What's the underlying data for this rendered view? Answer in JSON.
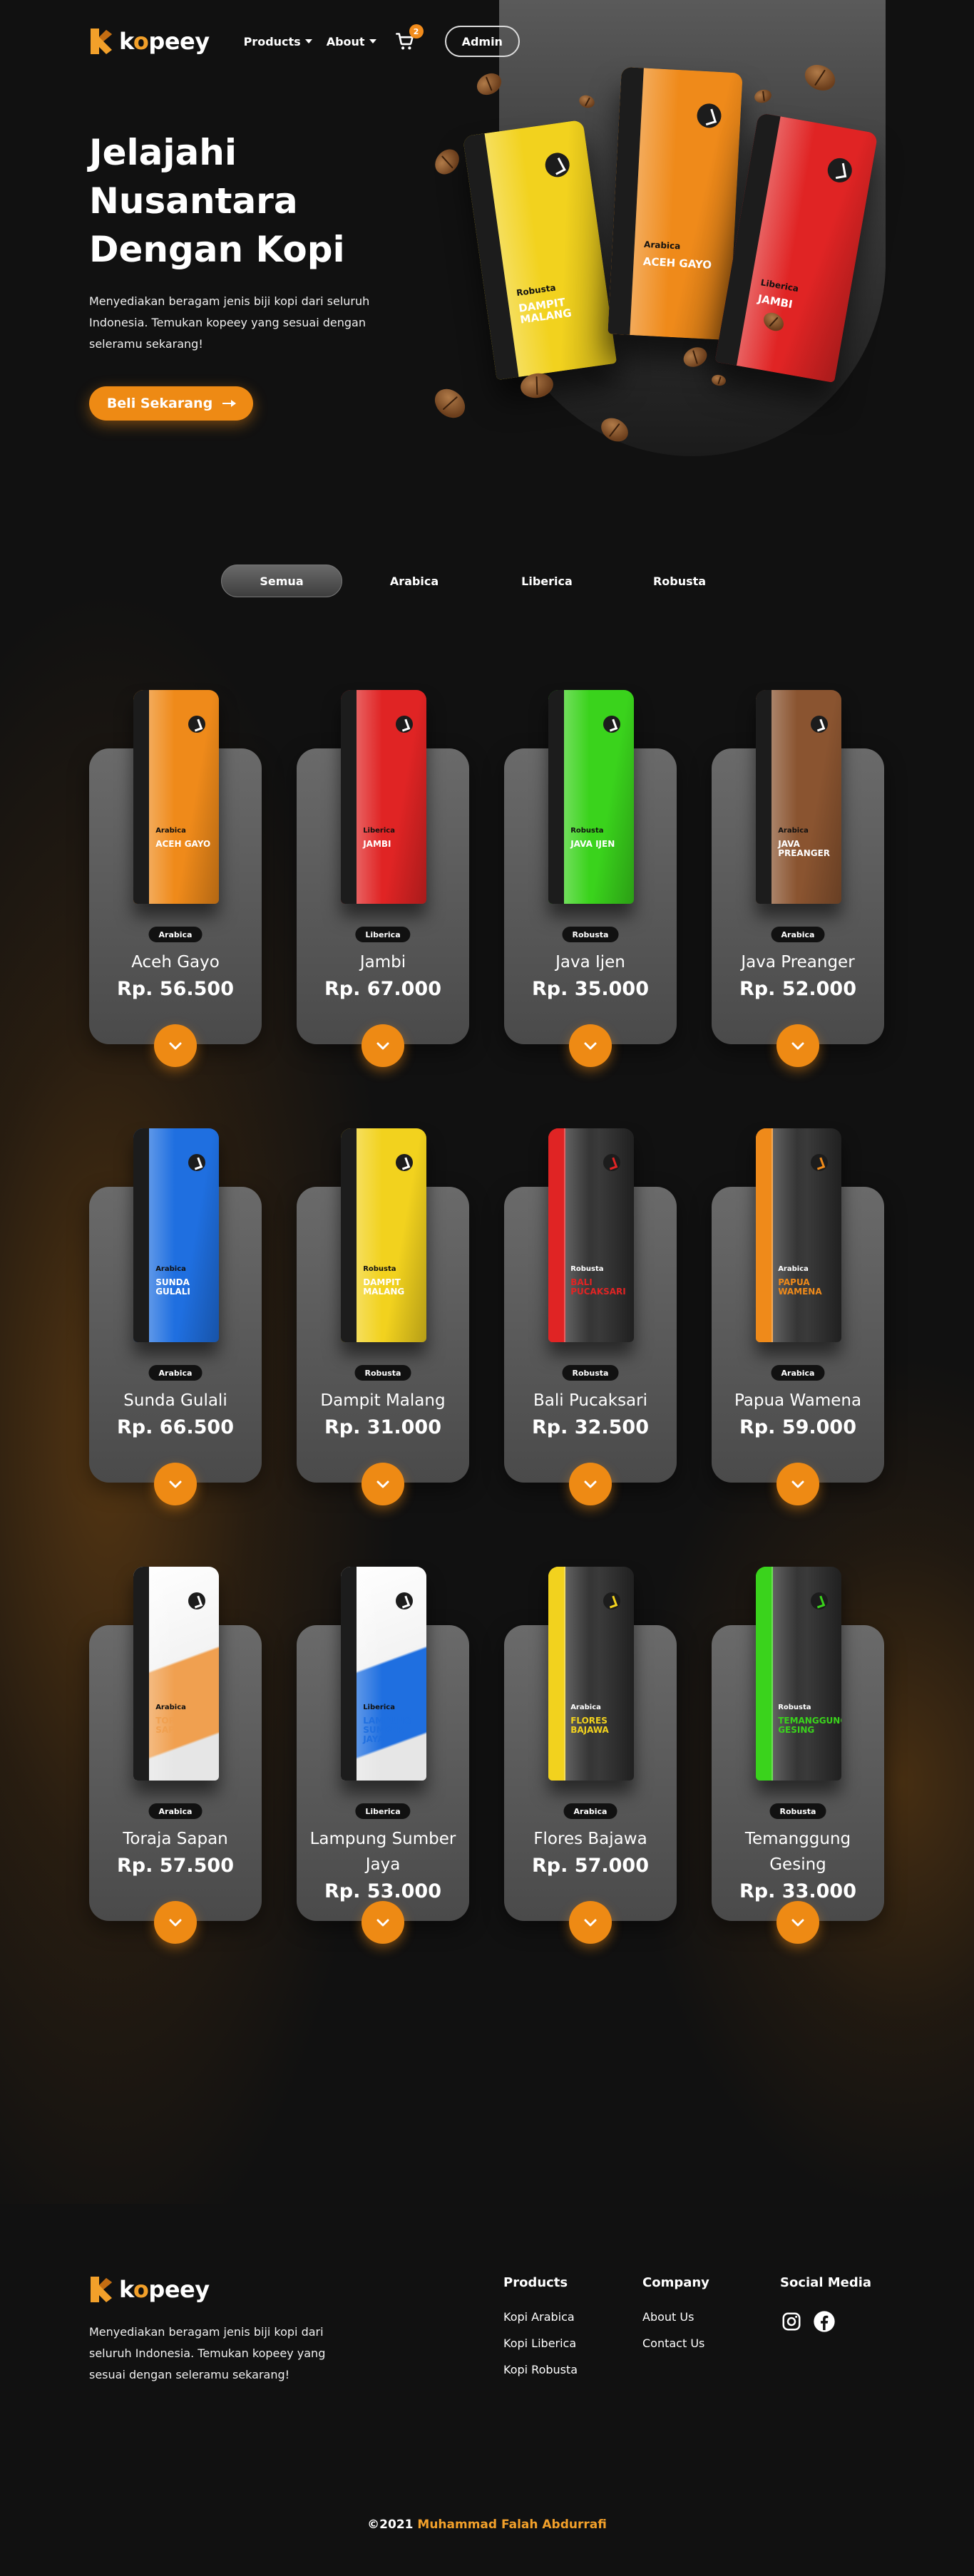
{
  "brand": {
    "name_prefix": "k",
    "name_o": "o",
    "name_suffix": "peey",
    "accent_color": "#ee8a14"
  },
  "nav": {
    "products_label": "Products",
    "about_label": "About",
    "cart_count": "2",
    "admin_label": "Admin"
  },
  "hero": {
    "title": "Jelajahi Nusantara Dengan Kopi",
    "description": "Menyediakan beragam jenis biji kopi dari seluruh Indonesia. Temukan kopeey yang sesuai dengan seleramu sekarang!",
    "cta_label": "Beli Sekarang",
    "bags": [
      {
        "type": "Robusta",
        "name": "Dampit Malang",
        "color": "#f2d21e"
      },
      {
        "type": "Arabica",
        "name": "Aceh Gayo",
        "color": "#ef8a1a"
      },
      {
        "type": "Liberica",
        "name": "Jambi",
        "color": "#e02424"
      }
    ]
  },
  "tabs": [
    {
      "label": "Semua",
      "active": true
    },
    {
      "label": "Arabica",
      "active": false
    },
    {
      "label": "Liberica",
      "active": false
    },
    {
      "label": "Robusta",
      "active": false
    }
  ],
  "products": [
    {
      "category": "Arabica",
      "name": "Aceh Gayo",
      "price": "Rp. 56.500",
      "color": "#ef8a1a",
      "dark": false
    },
    {
      "category": "Liberica",
      "name": "Jambi",
      "price": "Rp. 67.000",
      "color": "#e02424",
      "dark": false
    },
    {
      "category": "Robusta",
      "name": "Java Ijen",
      "price": "Rp. 35.000",
      "color": "#3ad31c",
      "dark": false
    },
    {
      "category": "Arabica",
      "name": "Java Preanger",
      "price": "Rp. 52.000",
      "color": "#8a5430",
      "dark": false
    },
    {
      "category": "Arabica",
      "name": "Sunda Gulali",
      "price": "Rp. 66.500",
      "color": "#1f6fe0",
      "dark": false
    },
    {
      "category": "Robusta",
      "name": "Dampit Malang",
      "price": "Rp. 31.000",
      "color": "#f2d21e",
      "dark": false
    },
    {
      "category": "Robusta",
      "name": "Bali Pucaksari",
      "price": "Rp. 32.500",
      "color": "#e02424",
      "dark": true
    },
    {
      "category": "Arabica",
      "name": "Papua Wamena",
      "price": "Rp. 59.000",
      "color": "#ef8a1a",
      "dark": true
    },
    {
      "category": "Arabica",
      "name": "Toraja Sapan",
      "price": "Rp. 57.500",
      "color": "#f0a050",
      "light": true
    },
    {
      "category": "Liberica",
      "name": "Lampung Sumber Jaya",
      "price": "Rp. 53.000",
      "color": "#1f6fe0",
      "light": true
    },
    {
      "category": "Arabica",
      "name": "Flores Bajawa",
      "price": "Rp. 57.000",
      "color": "#f2d21e",
      "dark": true
    },
    {
      "category": "Robusta",
      "name": "Temanggung Gesing",
      "price": "Rp. 33.000",
      "color": "#3ad31c",
      "dark": true
    }
  ],
  "footer": {
    "description": "Menyediakan beragam jenis biji kopi dari seluruh Indonesia. Temukan kopeey yang sesuai dengan seleramu sekarang!",
    "products_heading": "Products",
    "products_links": [
      "Kopi Arabica",
      "Kopi Liberica",
      "Kopi Robusta"
    ],
    "company_heading": "Company",
    "company_links": [
      "About Us",
      "Contact Us"
    ],
    "social_heading": "Social Media",
    "social_icons": [
      "instagram-icon",
      "facebook-icon"
    ],
    "copyright_prefix": "©2021",
    "copyright_author": "Muhammad Falah Abdurrafi"
  }
}
